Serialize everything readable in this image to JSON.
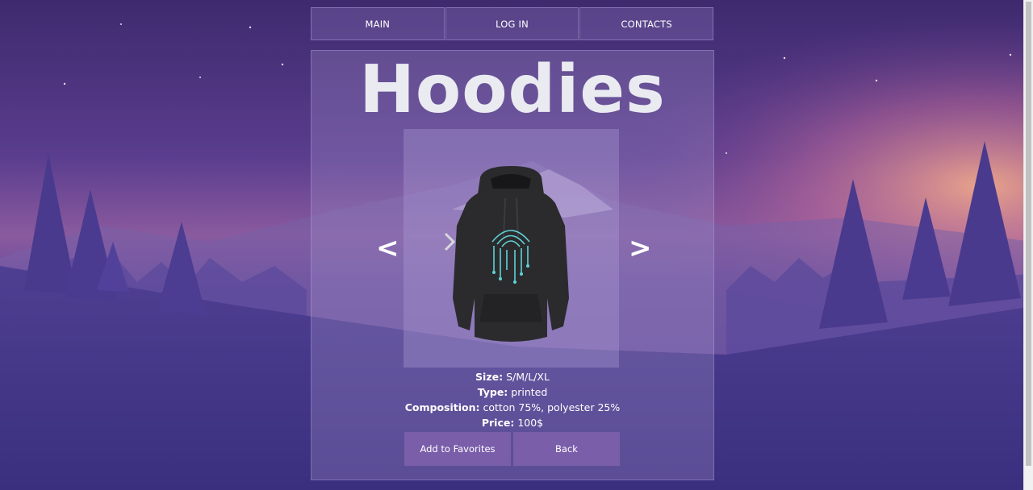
{
  "nav": {
    "items": [
      {
        "label": "MAIN"
      },
      {
        "label": "LOG IN"
      },
      {
        "label": "CONTACTS"
      }
    ]
  },
  "product": {
    "title": "Hoodies",
    "prev_label": "<",
    "next_label": ">",
    "specs": [
      {
        "label": "Size:",
        "value": "S/M/L/XL"
      },
      {
        "label": "Type:",
        "value": "printed"
      },
      {
        "label": "Composition:",
        "value": "cotton 75%, polyester 25%"
      },
      {
        "label": "Price:",
        "value": "100$"
      }
    ]
  },
  "actions": {
    "favorites_label": "Add to Favorites",
    "back_label": "Back"
  },
  "colors": {
    "button": "#7a5eaa",
    "title": "#e9ebf1",
    "hoodie_print": "#5fd3d6"
  },
  "icons": {
    "prev": "chevron-left-icon",
    "next": "chevron-right-icon"
  }
}
